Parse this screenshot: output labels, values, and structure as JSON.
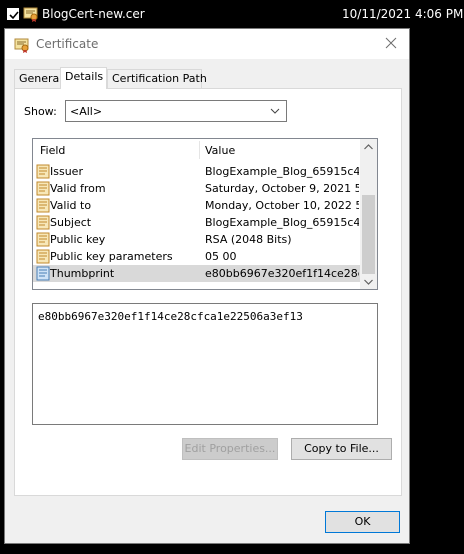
{
  "file_row": {
    "filename": "BlogCert-new.cer",
    "datetime": "10/11/2021 4:06 PM"
  },
  "dialog": {
    "title": "Certificate",
    "tabs": [
      {
        "label": "General"
      },
      {
        "label": "Details"
      },
      {
        "label": "Certification Path"
      }
    ],
    "show": {
      "label": "Show:",
      "selected": "<All>"
    },
    "list": {
      "columns": {
        "field": "Field",
        "value": "Value"
      },
      "rows": [
        {
          "field": "Issuer",
          "value": "BlogExample_Blog_65915c43-..."
        },
        {
          "field": "Valid from",
          "value": "Saturday, October 9, 2021 5:..."
        },
        {
          "field": "Valid to",
          "value": "Monday, October 10, 2022 5:..."
        },
        {
          "field": "Subject",
          "value": "BlogExample_Blog_65915c43-..."
        },
        {
          "field": "Public key",
          "value": "RSA (2048 Bits)"
        },
        {
          "field": "Public key parameters",
          "value": "05 00"
        },
        {
          "field": "Thumbprint",
          "value": "e80bb6967e320ef1f14ce28cfc..."
        }
      ]
    },
    "detail_text": "e80bb6967e320ef1f14ce28cfca1e22506a3ef13",
    "buttons": {
      "edit_properties": "Edit Properties...",
      "copy_to_file": "Copy to File...",
      "ok": "OK"
    }
  }
}
